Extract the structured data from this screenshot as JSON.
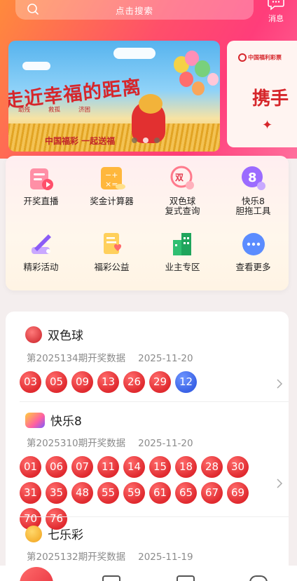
{
  "header": {
    "search_placeholder": "点击搜索",
    "message_label": "消息"
  },
  "banner": {
    "title": "走近幸福的距离",
    "subtitle_items": [
      "助残",
      "救孤",
      "济困"
    ],
    "slogan": "中国福彩 一起送福",
    "side_logo_text": "中国福利彩票",
    "side_text": "携手",
    "carousel_count": 3,
    "carousel_active_index": 2
  },
  "menu": {
    "items": [
      {
        "label": "开奖直播",
        "icon": "live-tv-icon"
      },
      {
        "label": "奖金计算器",
        "icon": "calculator-icon"
      },
      {
        "label": "双色球\n复式查询",
        "icon": "double-ball-query-icon"
      },
      {
        "label": "快乐8\n胆拖工具",
        "icon": "happy8-tool-icon"
      },
      {
        "label": "精彩活动",
        "icon": "activity-icon"
      },
      {
        "label": "福彩公益",
        "icon": "charity-icon"
      },
      {
        "label": "业主专区",
        "icon": "building-icon"
      },
      {
        "label": "查看更多",
        "icon": "more-icon"
      }
    ]
  },
  "lotteries": [
    {
      "name": "双色球",
      "period": "第2025134期开奖数据",
      "date": "2025-11-20",
      "red_balls": [
        "03",
        "05",
        "09",
        "13",
        "26",
        "29"
      ],
      "blue_balls": [
        "12"
      ]
    },
    {
      "name": "快乐8",
      "period": "第2025310期开奖数据",
      "date": "2025-11-20",
      "red_balls": [
        "01",
        "06",
        "07",
        "11",
        "14",
        "15",
        "18",
        "28",
        "30",
        "31",
        "35",
        "48",
        "55",
        "59",
        "61",
        "65",
        "67",
        "69",
        "70",
        "76"
      ],
      "blue_balls": []
    },
    {
      "name": "七乐彩",
      "period": "第2025132期开奖数据",
      "date": "2025-11-19",
      "red_balls": [],
      "blue_balls": []
    }
  ],
  "colors": {
    "accent_red": "#e02a2f",
    "blue_ball": "#3a62e6"
  }
}
